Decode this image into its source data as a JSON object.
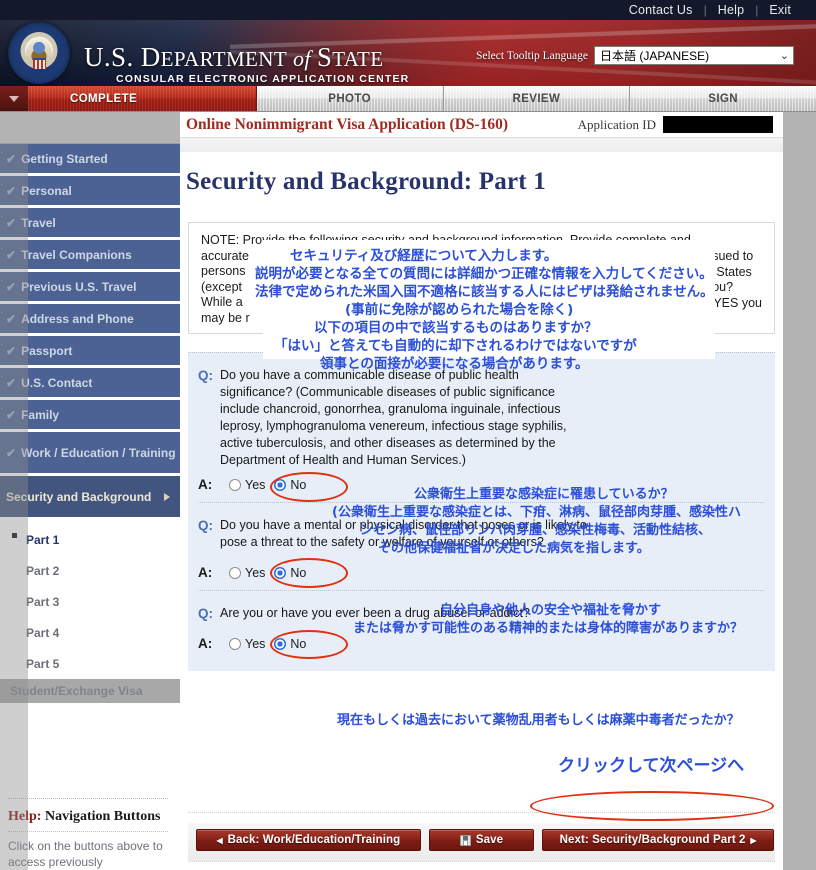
{
  "topbar": {
    "links": [
      "Contact Us",
      "Help",
      "Exit"
    ],
    "divider": "|"
  },
  "banner": {
    "title_us": "U.S. ",
    "title_dept": "D",
    "title_dept_rest": "EPARTMENT",
    "title_of": "of ",
    "title_state": "S",
    "title_state_rest": "TATE",
    "subtitle": "CONSULAR ELECTRONIC APPLICATION CENTER",
    "language_label": "Select Tooltip Language",
    "language_value": "日本語 (JAPANESE)",
    "chevron": "⌄",
    "seal_name": "us-department-of-state-seal"
  },
  "tabs": [
    {
      "label": "COMPLETE",
      "active": true
    },
    {
      "label": "PHOTO",
      "active": false
    },
    {
      "label": "REVIEW",
      "active": false
    },
    {
      "label": "SIGN",
      "active": false
    }
  ],
  "sidebar": {
    "items": [
      {
        "label": "Getting Started",
        "check": "✔"
      },
      {
        "label": "Personal",
        "check": "✔"
      },
      {
        "label": "Travel",
        "check": "✔"
      },
      {
        "label": "Travel Companions",
        "check": "✔"
      },
      {
        "label": "Previous U.S. Travel",
        "check": "✔"
      },
      {
        "label": "Address and Phone",
        "check": "✔"
      },
      {
        "label": "Passport",
        "check": "✔"
      },
      {
        "label": "U.S. Contact",
        "check": "✔"
      },
      {
        "label": "Family",
        "check": "✔"
      },
      {
        "label": "Work / Education / Training",
        "check": "✔"
      }
    ],
    "current": {
      "label": "Security and Background"
    },
    "subitems": [
      {
        "label": "Part 1",
        "active": true
      },
      {
        "label": "Part 2",
        "active": false
      },
      {
        "label": "Part 3",
        "active": false
      },
      {
        "label": "Part 4",
        "active": false
      },
      {
        "label": "Part 5",
        "active": false
      }
    ],
    "student_visa": "Student/Exchange Visa",
    "help": {
      "prefix": "Help:",
      "title": " Navigation Buttons",
      "text": "Click on the buttons above to access previously"
    }
  },
  "content": {
    "breadcrumb_title": "Online Nonimmigrant Visa Application (DS-160)",
    "application_id_label": "Application ID",
    "application_id_value": "",
    "page_title": "Security and Background: Part 1",
    "note": {
      "line1": "NOTE: Provide the following security and background information. Provide complete and",
      "line2_left": "accurate",
      "line2_right": "ssued to",
      "line3_left": "persons",
      "line3_right": "d States",
      "line4_left": "(except",
      "line4_right": "you?",
      "line5_left": "While a",
      "line5_right": "r YES you",
      "line6_left": "may be r",
      "overlay": [
        "セキュリティ及び経歴について入力します。",
        "説明が必要となる全ての質問には詳細かつ正確な情報を入力してください。",
        "法律で定められた米国入国不適格に該当する人にはビザは発給されません。",
        "(事前に免除が認められた場合を除く)",
        "以下の項目の中で該当するものはありますか？",
        "「はい」と答えても自動的に却下されるわけではないですが",
        "領事との面接が必要になる場合があります。"
      ]
    },
    "questions": [
      {
        "q_mark": "Q:",
        "a_mark": "A:",
        "question": "Do you have a communicable disease of public health significance? (Communicable diseases of public significance include chancroid, gonorrhea, granuloma inguinale, infectious leprosy, lymphogranuloma venereum, infectious stage syphilis, active tuberculosis, and other diseases as determined by the Department of Health and Human Services.)",
        "yes_label": "Yes",
        "no_label": "No",
        "selected": "No",
        "annotation": [
          "公衆衛生上重要な感染症に罹患しているか？",
          "(公衆衛生上重要な感染症とは、下疳、淋病、鼠径部肉芽腫、感染性ハ",
          "ンセン病、鼠径部リンパ肉芽腫、感染性梅毒、活動性結核、",
          "その他保健福祉省が決定した病気を指します。"
        ]
      },
      {
        "q_mark": "Q:",
        "a_mark": "A:",
        "question": "Do you have a mental or physical disorder that poses or is likely to pose a threat to the safety or welfare of yourself or others?",
        "yes_label": "Yes",
        "no_label": "No",
        "selected": "No",
        "annotation": [
          "自分自身や他人の安全や福祉を脅かす",
          "または脅かす可能性のある精神的または身体的障害がありますか？"
        ]
      },
      {
        "q_mark": "Q:",
        "a_mark": "A:",
        "question": "Are you or have you ever been a drug abuser or addict?",
        "yes_label": "Yes",
        "no_label": "No",
        "selected": "No",
        "annotation": [
          "現在もしくは過去において薬物乱用者もしくは麻薬中毒者だったか？"
        ]
      }
    ],
    "next_page_annotation": "クリックして次ページへ",
    "buttons": {
      "back": "Back: Work/Education/Training",
      "back_arrow": "◂",
      "save": "Save",
      "next": "Next: Security/Background Part 2",
      "next_arrow": "▸"
    }
  },
  "colors": {
    "brand_red": "#9e2b20",
    "nav_blue": "#4c6293",
    "title_blue": "#27346b",
    "annotation_blue": "#2b4fd8",
    "ellipse_red": "#e03010",
    "panel_blue": "#e8eef7"
  }
}
